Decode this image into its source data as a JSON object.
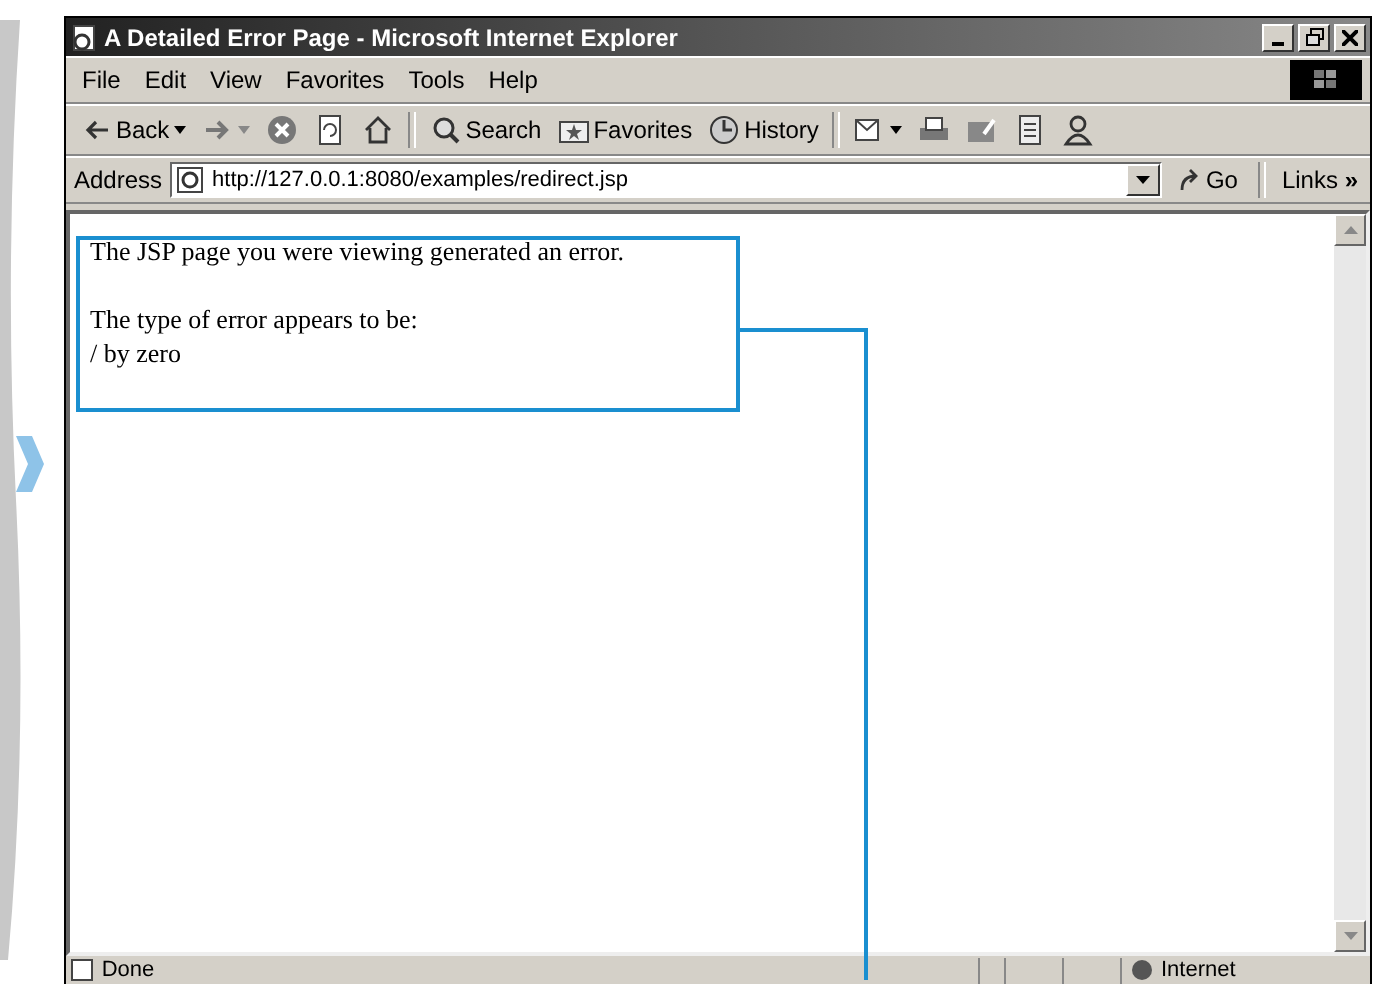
{
  "window": {
    "title": "A Detailed Error Page - Microsoft Internet Explorer"
  },
  "menu": [
    "File",
    "Edit",
    "View",
    "Favorites",
    "Tools",
    "Help"
  ],
  "toolbar": [
    {
      "kind": "back",
      "label": "Back"
    },
    {
      "kind": "forward"
    },
    {
      "kind": "stop"
    },
    {
      "kind": "refresh"
    },
    {
      "kind": "home"
    },
    {
      "kind": "search",
      "label": "Search"
    },
    {
      "kind": "favorites",
      "label": "Favorites"
    },
    {
      "kind": "history",
      "label": "History"
    },
    {
      "kind": "mail"
    },
    {
      "kind": "print"
    },
    {
      "kind": "edit"
    },
    {
      "kind": "discuss"
    },
    {
      "kind": "messenger"
    }
  ],
  "address": {
    "label": "Address",
    "url": "http://127.0.0.1:8080/examples/redirect.jsp",
    "go": "Go",
    "links": "Links",
    "links_more": "»"
  },
  "page": {
    "paragraphs": [
      [
        "The JSP page you were viewing generated an error."
      ],
      [
        "The type of error appears to be:",
        "/ by zero"
      ]
    ]
  },
  "status_bar": {
    "text": "Done",
    "zone": "Internet"
  }
}
